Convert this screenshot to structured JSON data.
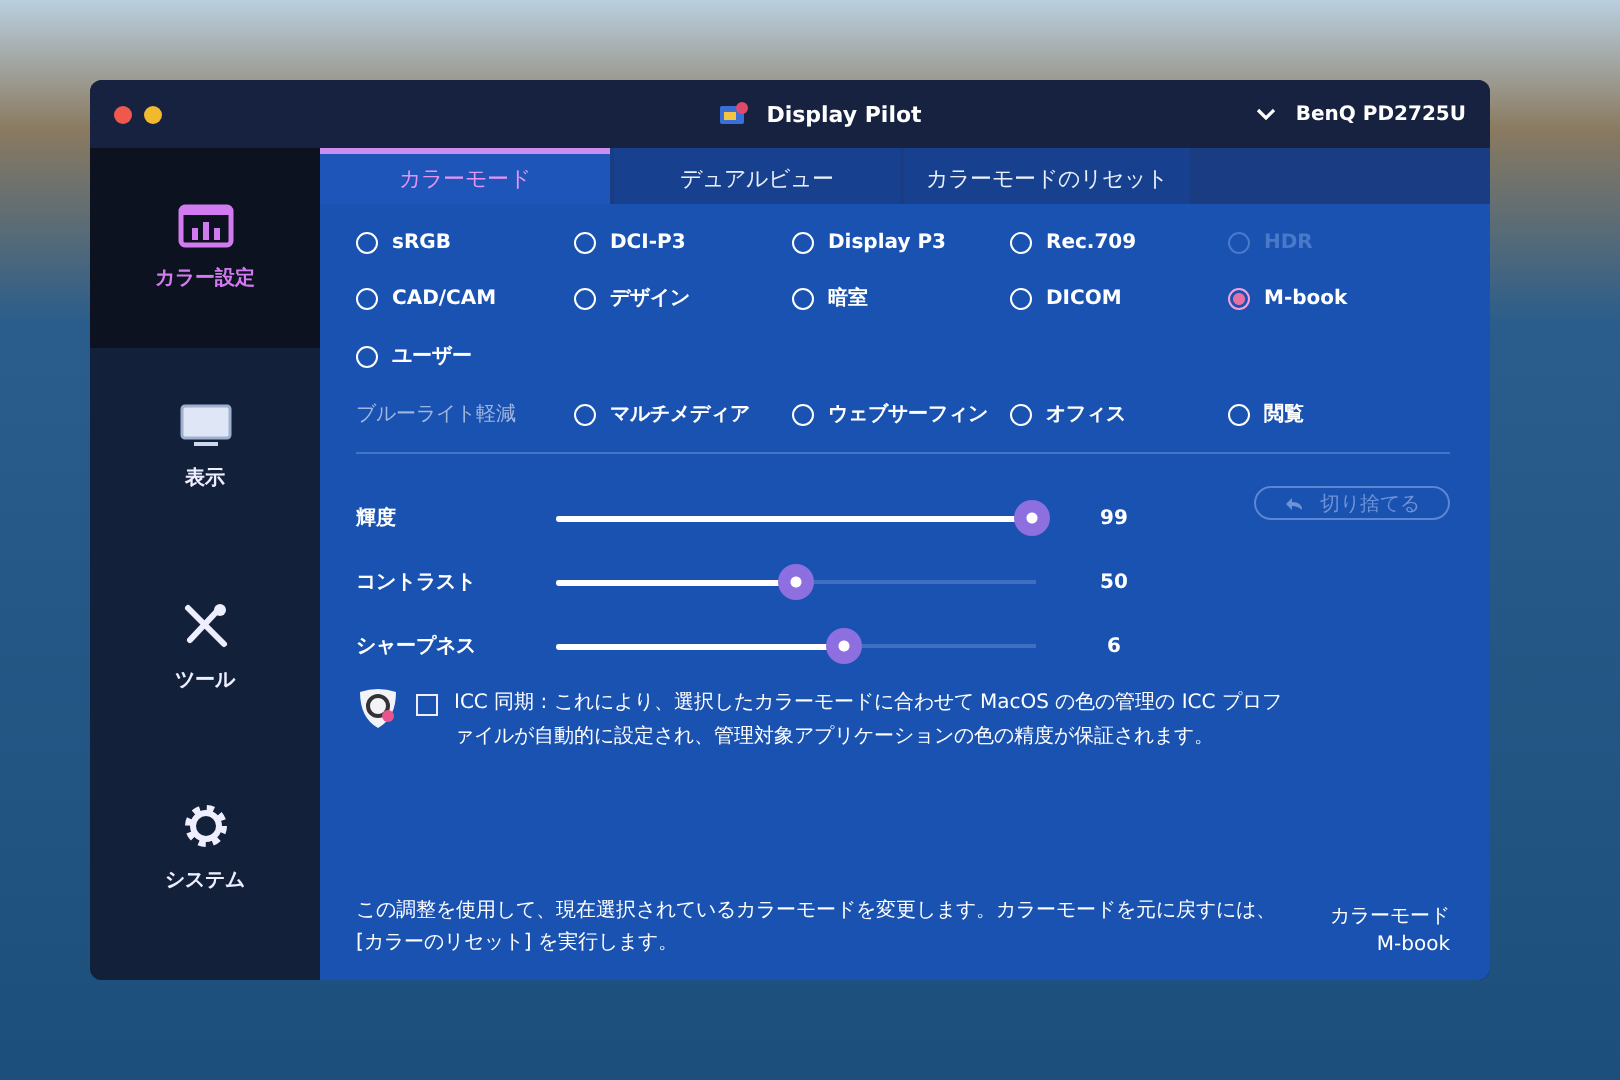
{
  "window": {
    "title": "Display Pilot",
    "monitor": "BenQ PD2725U"
  },
  "sidebar": {
    "items": [
      {
        "label": "カラー設定",
        "kind": "chart",
        "selected": true
      },
      {
        "label": "表示",
        "kind": "monitor",
        "selected": false
      },
      {
        "label": "ツール",
        "kind": "tools",
        "selected": false
      },
      {
        "label": "システム",
        "kind": "gear",
        "selected": false
      }
    ]
  },
  "tabs": [
    {
      "label": "カラーモード",
      "selected": true
    },
    {
      "label": "デュアルビュー",
      "selected": false
    },
    {
      "label": "カラーモードのリセット",
      "selected": false
    }
  ],
  "color_modes": [
    {
      "label": "sRGB",
      "selected": false,
      "disabled": false
    },
    {
      "label": "DCI-P3",
      "selected": false,
      "disabled": false
    },
    {
      "label": "Display P3",
      "selected": false,
      "disabled": false
    },
    {
      "label": "Rec.709",
      "selected": false,
      "disabled": false
    },
    {
      "label": "HDR",
      "selected": false,
      "disabled": true
    },
    {
      "label": "CAD/CAM",
      "selected": false,
      "disabled": false
    },
    {
      "label": "デザイン",
      "selected": false,
      "disabled": false
    },
    {
      "label": "暗室",
      "selected": false,
      "disabled": false
    },
    {
      "label": "DICOM",
      "selected": false,
      "disabled": false
    },
    {
      "label": "M-book",
      "selected": true,
      "disabled": false
    },
    {
      "label": "ユーザー",
      "selected": false,
      "disabled": false
    }
  ],
  "blue_light": {
    "label": "ブルーライト軽減",
    "options": [
      {
        "label": "マルチメディア",
        "selected": false
      },
      {
        "label": "ウェブサーフィン",
        "selected": false
      },
      {
        "label": "オフィス",
        "selected": false
      },
      {
        "label": "閲覧",
        "selected": false
      }
    ]
  },
  "discard_button": {
    "label": "切り捨てる",
    "disabled": true
  },
  "sliders": [
    {
      "name": "輝度",
      "level": 0.99,
      "reading": "99"
    },
    {
      "name": "コントラスト",
      "level": 0.5,
      "reading": "50"
    },
    {
      "name": "シャープネス",
      "level": 0.6,
      "reading": "6"
    }
  ],
  "icc_sync": {
    "checked": false,
    "text": "ICC 同期 : これにより、選択したカラーモードに合わせて MacOS の色の管理の ICC プロファイルが自動的に設定され、管理対象アプリケーションの色の精度が保証されます。"
  },
  "footer": {
    "note": "この調整を使用して、現在選択されているカラーモードを変更します。カラーモードを元に戻すには、[カラーのリセット] を実行します。",
    "mode_label": "カラーモード",
    "mode_value": "M-book"
  }
}
